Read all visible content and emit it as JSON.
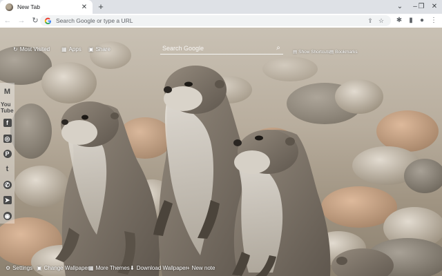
{
  "tab": {
    "title": "New Tab",
    "close": "✕"
  },
  "newtab_symbol": "+",
  "window": {
    "minimize": "⌄",
    "min2": "–",
    "restore": "❐",
    "close": "✕"
  },
  "nav": {
    "back": "←",
    "forward": "→",
    "reload": "↻"
  },
  "omnibox": {
    "placeholder": "Search Google or type a URL"
  },
  "toolbar_icons": {
    "share": "⇪",
    "star": "☆",
    "extensions": "✱",
    "sidepanel": "▮",
    "profile": "●",
    "menu": "⋮"
  },
  "top_links": {
    "most_visited": "Most Visited",
    "apps": "Apps",
    "share": "Share",
    "show_shortcuts": "Show Shortcuts",
    "bookmarks": "Bookmarks"
  },
  "search": {
    "placeholder": "Search Google"
  },
  "social": [
    "M",
    "You Tube",
    "f",
    "◎",
    "P",
    "t",
    "✆",
    "➤",
    "◉"
  ],
  "bottom": {
    "settings": "Settings",
    "change_wallpaper": "Change Wallpaper",
    "more_themes": "More Themes",
    "download_wallpaper": "Download Wallpaper",
    "new_note": "New note"
  },
  "colors": {
    "chrome_bg": "#dee1e6",
    "toolbar": "#ffffff",
    "omnibox": "#f1f3f4",
    "otter_fur": "#7e756a"
  }
}
